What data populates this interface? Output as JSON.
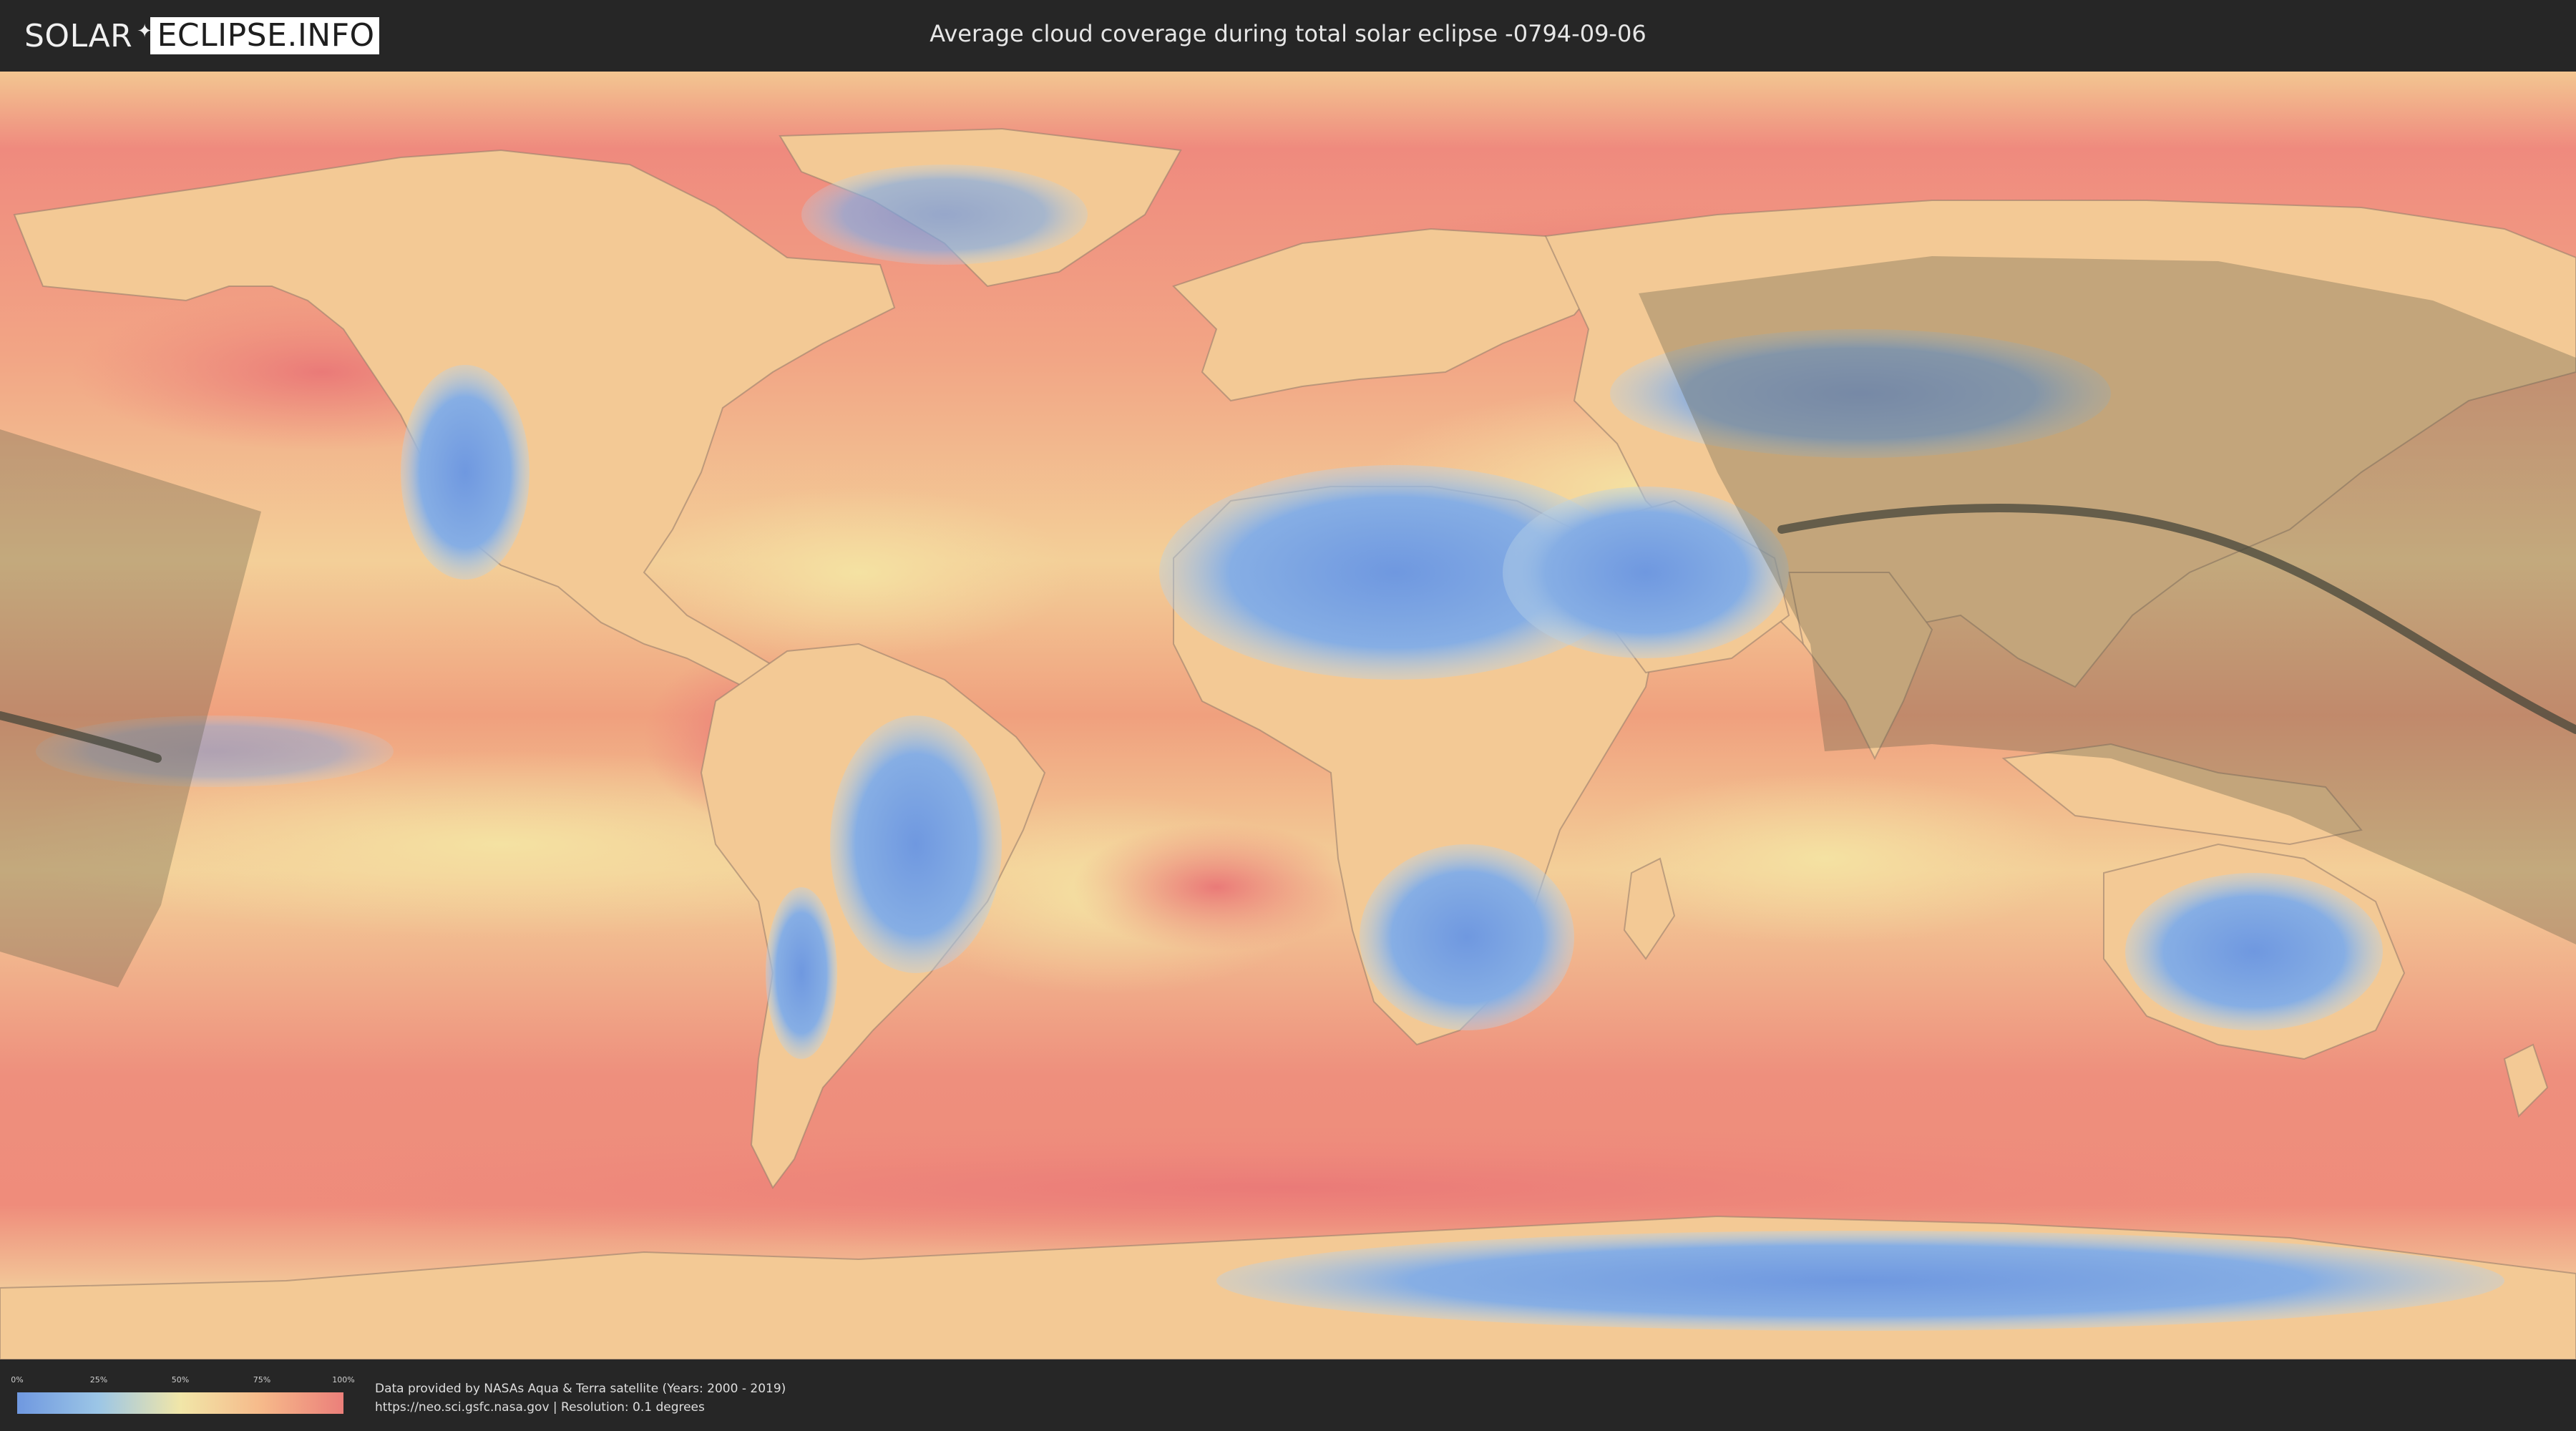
{
  "header": {
    "logo_left": "SOLAR",
    "logo_right": "ECLIPSE.INFO",
    "title": "Average cloud coverage during total solar eclipse -0794-09-06"
  },
  "legend": {
    "ticks": [
      "0%",
      "25%",
      "50%",
      "75%",
      "100%"
    ],
    "tick_positions": [
      0,
      25,
      50,
      75,
      100
    ],
    "colors": [
      "#6f98e0",
      "#9cc6e6",
      "#f1e6a8",
      "#f6b98a",
      "#eb7f7a"
    ]
  },
  "footer": {
    "line1": "Data provided by NASAs Aqua & Terra satellite (Years: 2000 - 2019)",
    "line2": "https://neo.sci.gsfc.nasa.gov | Resolution: 0.1 degrees"
  },
  "map": {
    "projection": "equirectangular",
    "layer": "cloud-coverage",
    "ocean_color": "#f0a88a",
    "dry_land_color": "#7fa6e2",
    "shadow_color": "#7a7760",
    "path_line_color": "#4a4a42"
  }
}
